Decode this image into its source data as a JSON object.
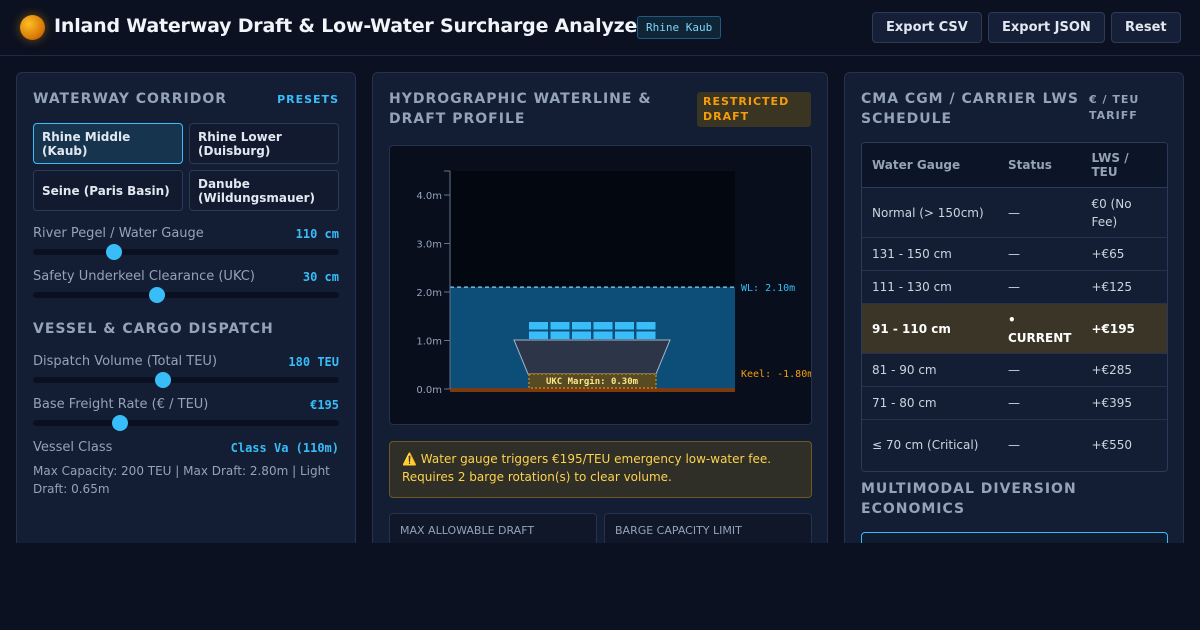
{
  "header": {
    "title": "Inland Waterway Draft & Low-Water Surcharge Analyzer",
    "location_badge": "Rhine Kaub",
    "buttons": {
      "export_csv": "Export CSV",
      "export_json": "Export JSON",
      "reset": "Reset"
    }
  },
  "corridor": {
    "title": "Waterway Corridor",
    "presets_link": "PRESETS",
    "presets": [
      "Rhine Middle (Kaub)",
      "Rhine Lower (Duisburg)",
      "Seine (Paris Basin)",
      "Danube (Wildungsmauer)"
    ],
    "active_preset": "Rhine Middle (Kaub)",
    "sliders": [
      {
        "label": "River Pegel / Water Gauge",
        "value": "110 cm",
        "level": 0.265
      },
      {
        "label": "Safety Underkeel Clearance (UKC)",
        "value": "30 cm",
        "level": 0.405
      }
    ]
  },
  "dispatch": {
    "title": "Vessel & Cargo Dispatch",
    "sliders": [
      {
        "label": "Dispatch Volume (Total TEU)",
        "value": "180 TEU",
        "level": 0.425
      },
      {
        "label": "Base Freight Rate (€ / TEU)",
        "value": "€195",
        "level": 0.285
      }
    ],
    "vessel_class_label": "Vessel Class",
    "vessel_class_value": "Class Va (110m)",
    "vessel_info": "Max Capacity: 200 TEU | Max Draft: 2.80m | Light Draft: 0.65m"
  },
  "profile": {
    "title": "Hydrographic Waterline & Draft Profile",
    "status_badge": "RESTRICTED DRAFT",
    "alert_icon": "⚠️",
    "alert_text": "Water gauge triggers €195/TEU emergency low-water fee. Requires 2 barge rotation(s) to clear volume.",
    "metric_cards": [
      "MAX ALLOWABLE DRAFT",
      "BARGE CAPACITY LIMIT"
    ]
  },
  "chart_data": {
    "type": "area",
    "y_ticks": [
      "0.0m",
      "1.0m",
      "2.0m",
      "3.0m",
      "4.0m"
    ],
    "ylim": [
      0,
      4.5
    ],
    "waterline": 2.1,
    "waterline_label": "WL: 2.10m",
    "keel_label": "Keel: -1.80m",
    "ukc_label": "UKC Margin: 0.30m",
    "colors": {
      "water": "#0e5a8a",
      "vessel": "#2c3648",
      "container": "#38bdf8",
      "keel": "#f59e0b",
      "riverbed": "#7c3a10"
    }
  },
  "schedule": {
    "title": "CMA CGM / Carrier LWS Schedule",
    "tariff_link": "€ / TEU TARIFF",
    "columns": [
      "Water Gauge",
      "Status",
      "LWS / TEU"
    ],
    "rows": [
      {
        "gauge": "Normal (> 150cm)",
        "status": "—",
        "fee": "€0 (No Fee)",
        "current": false
      },
      {
        "gauge": "131 - 150 cm",
        "status": "—",
        "fee": "+€65",
        "current": false
      },
      {
        "gauge": "111 - 130 cm",
        "status": "—",
        "fee": "+€125",
        "current": false
      },
      {
        "gauge": "91 - 110 cm",
        "status": "• CURRENT",
        "fee": "+€195",
        "current": true
      },
      {
        "gauge": "81 - 90 cm",
        "status": "—",
        "fee": "+€285",
        "current": false
      },
      {
        "gauge": "71 - 80 cm",
        "status": "—",
        "fee": "+€395",
        "current": false
      },
      {
        "gauge": "≤ 70 cm (Critical)",
        "status": "—",
        "fee": "+€550",
        "current": false
      }
    ]
  },
  "diversion": {
    "title": "Multimodal Diversion Economics"
  }
}
